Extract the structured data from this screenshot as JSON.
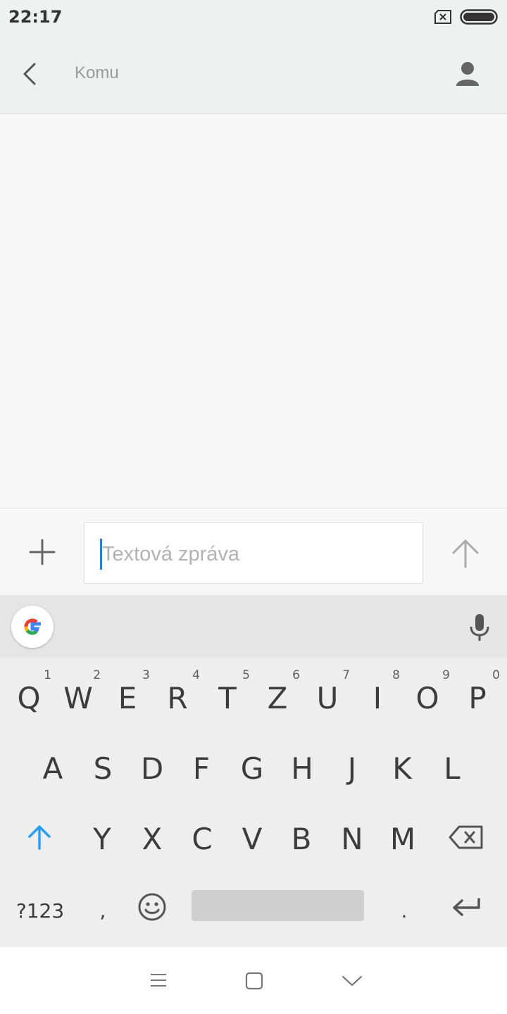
{
  "status_bar": {
    "time": "22:17",
    "icons": [
      "sim-x-icon",
      "battery-icon"
    ]
  },
  "header": {
    "to_label": "Komu",
    "icons": [
      "back-icon",
      "contact-icon"
    ]
  },
  "compose": {
    "placeholder": "Textová zpráva",
    "icons": [
      "plus-icon",
      "send-arrow-icon"
    ]
  },
  "keyboard": {
    "row1": [
      {
        "label": "Q",
        "sup": "1"
      },
      {
        "label": "W",
        "sup": "2"
      },
      {
        "label": "E",
        "sup": "3"
      },
      {
        "label": "R",
        "sup": "4"
      },
      {
        "label": "T",
        "sup": "5"
      },
      {
        "label": "Z",
        "sup": "6"
      },
      {
        "label": "U",
        "sup": "7"
      },
      {
        "label": "I",
        "sup": "8"
      },
      {
        "label": "O",
        "sup": "9"
      },
      {
        "label": "P",
        "sup": "0"
      }
    ],
    "row2": [
      "A",
      "S",
      "D",
      "F",
      "G",
      "H",
      "J",
      "K",
      "L"
    ],
    "row3": [
      "Y",
      "X",
      "C",
      "V",
      "B",
      "N",
      "M"
    ],
    "row4": {
      "symbols": "?123",
      "comma": ",",
      "period": "."
    },
    "icons": [
      "google-icon",
      "mic-icon",
      "shift-icon",
      "backspace-icon",
      "emoji-icon",
      "enter-icon"
    ],
    "accent_color": "#2a9df4"
  },
  "nav_bar": {
    "icons": [
      "menu-icon",
      "home-icon",
      "back-chevron-icon"
    ]
  }
}
